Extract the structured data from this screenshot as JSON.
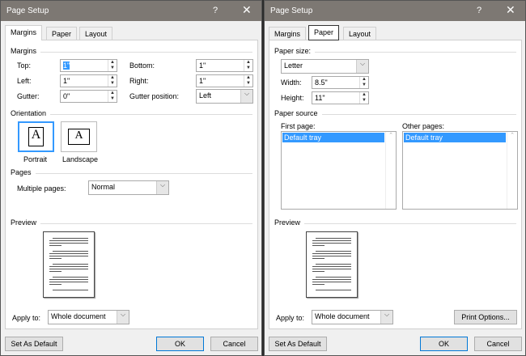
{
  "title": "Page Setup",
  "help": "?",
  "close": "✕",
  "tabs": [
    "Margins",
    "Paper",
    "Layout"
  ],
  "margins": {
    "group": "Margins",
    "top_label": "Top:",
    "top": "1\"",
    "bottom_label": "Bottom:",
    "bottom": "1\"",
    "left_label": "Left:",
    "left": "1\"",
    "right_label": "Right:",
    "right": "1\"",
    "gutter_label": "Gutter:",
    "gutter": "0\"",
    "gutter_pos_label": "Gutter position:",
    "gutter_pos": "Left",
    "orientation": "Orientation",
    "portrait": "Portrait",
    "landscape": "Landscape",
    "pages": "Pages",
    "multiple_label": "Multiple pages:",
    "multiple": "Normal"
  },
  "paper": {
    "size_group": "Paper size:",
    "size": "Letter",
    "width_label": "Width:",
    "width": "8.5\"",
    "height_label": "Height:",
    "height": "11\"",
    "source_group": "Paper source",
    "first_label": "First page:",
    "first": "Default tray",
    "other_label": "Other pages:",
    "other": "Default tray",
    "print_options": "Print Options..."
  },
  "preview": "Preview",
  "apply_label": "Apply to:",
  "apply": "Whole document",
  "set_default": "Set As Default",
  "ok": "OK",
  "cancel": "Cancel"
}
